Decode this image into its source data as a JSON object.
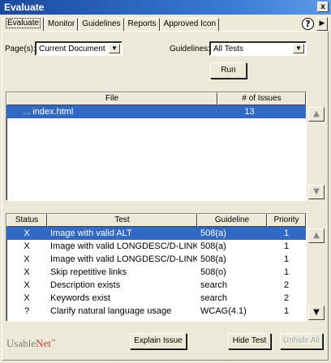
{
  "window": {
    "title": "Evaluate",
    "close_label": "x"
  },
  "tabs": [
    {
      "label": "Evaluate",
      "active": true
    },
    {
      "label": "Monitor"
    },
    {
      "label": "Guidelines"
    },
    {
      "label": "Reports"
    },
    {
      "label": "Approved Icon"
    }
  ],
  "help_label": "?",
  "tab_scroll_label": "▶",
  "filters": {
    "pages_label": "Page(s):",
    "pages_value": "Current Document",
    "guidelines_label": "Guidelines:",
    "guidelines_value": "All Tests"
  },
  "run_label": "Run",
  "file_table": {
    "headers": [
      "File",
      "# of Issues"
    ],
    "rows": [
      {
        "file": "... index.html",
        "issues": "13",
        "selected": true
      }
    ]
  },
  "test_table": {
    "headers": [
      "Status",
      "Test",
      "Guideline",
      "Priority"
    ],
    "rows": [
      {
        "status": "X",
        "test": "Image with valid ALT",
        "guideline": "508(a)",
        "priority": "1",
        "selected": true
      },
      {
        "status": "X",
        "test": "Image with valid LONGDESC/D-LINK",
        "guideline": "508(a)",
        "priority": "1"
      },
      {
        "status": "X",
        "test": "Image with valid LONGDESC/D-LINK",
        "guideline": "508(a)",
        "priority": "1"
      },
      {
        "status": "X",
        "test": "Skip repetitive links",
        "guideline": "508(o)",
        "priority": "1"
      },
      {
        "status": "X",
        "test": "Description exists",
        "guideline": "search",
        "priority": "2"
      },
      {
        "status": "X",
        "test": "Keywords exist",
        "guideline": "search",
        "priority": "2"
      },
      {
        "status": "?",
        "test": "Clarify natural language usage",
        "guideline": "WCAG(4.1)",
        "priority": "1"
      }
    ]
  },
  "logo": {
    "usable": "Usable",
    "net": "Net",
    "tm": "™"
  },
  "buttons": {
    "explain": "Explain Issue",
    "hide": "Hide Test",
    "unhide": "Unhide All"
  },
  "colors": {
    "selection": "#316ac5",
    "title_bar": "#1a4a9e",
    "logo_red": "#c3402f"
  }
}
